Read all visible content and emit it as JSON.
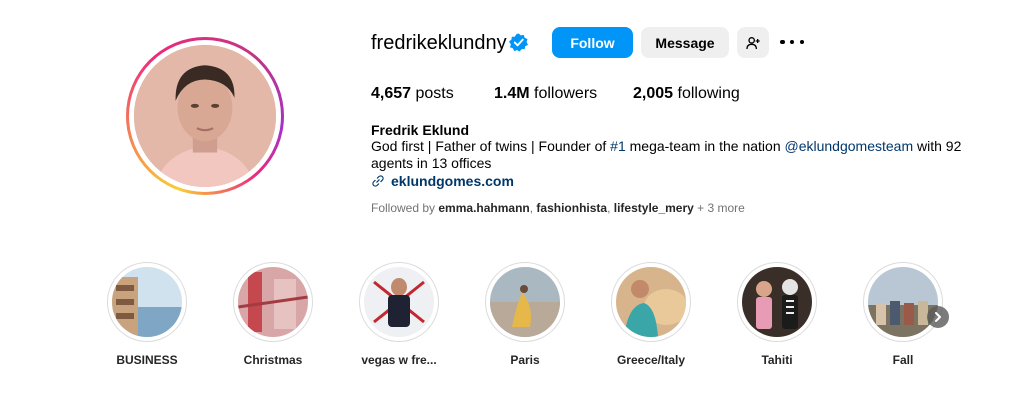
{
  "profile": {
    "username": "fredrikeklundny",
    "verified": true,
    "full_name": "Fredrik Eklund",
    "bio_prefix": "God first | Father of twins | Founder of ",
    "bio_hashtag": "#1",
    "bio_middle": " mega-team in the nation ",
    "bio_mention": "@eklundgomesteam",
    "bio_suffix": " with 92 agents in 13 offices",
    "website": "eklundgomes.com",
    "avatar_icon": "profile-photo"
  },
  "actions": {
    "follow_label": "Follow",
    "message_label": "Message",
    "suggest_icon": "person-plus-icon",
    "more_icon": "more-horizontal-icon"
  },
  "stats": {
    "posts_count": "4,657",
    "posts_label": " posts",
    "followers_count": "1.4M",
    "followers_label": " followers",
    "following_count": "2,005",
    "following_label": " following"
  },
  "followed_by": {
    "prefix": "Followed by ",
    "user1": "emma.hahmann",
    "sep1": ", ",
    "user2": "fashionhista",
    "sep2": ", ",
    "user3": "lifestyle_mery",
    "suffix": " + 3 more"
  },
  "highlights": [
    {
      "label": "BUSINESS"
    },
    {
      "label": "Christmas"
    },
    {
      "label": "vegas w fre..."
    },
    {
      "label": "Paris"
    },
    {
      "label": "Greece/Italy"
    },
    {
      "label": "Tahiti"
    },
    {
      "label": "Fall"
    }
  ],
  "colors": {
    "follow_blue": "#0095f6",
    "link_blue": "#00376b",
    "secondary_button": "#efefef",
    "muted_text": "#737373"
  }
}
